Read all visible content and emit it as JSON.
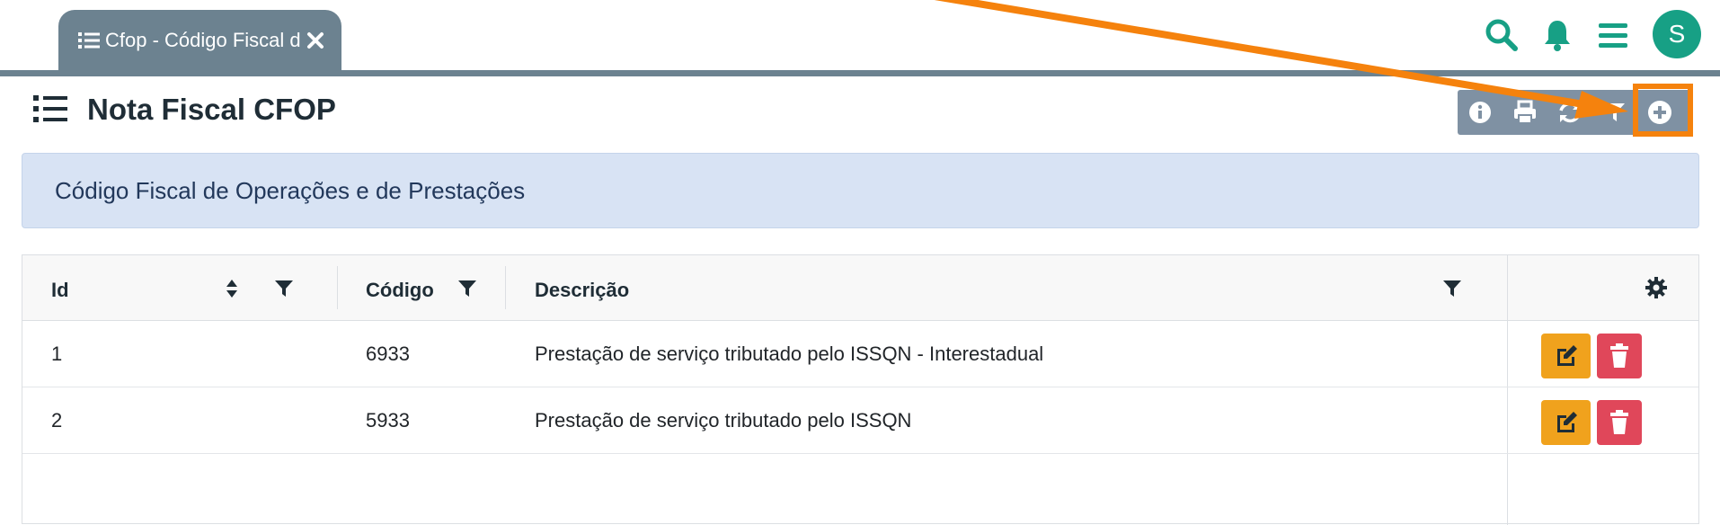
{
  "tab": {
    "label": "Cfop - Código Fiscal de Operações e de Prestações"
  },
  "user": {
    "initial": "S"
  },
  "page": {
    "title": "Nota Fiscal CFOP"
  },
  "banner": {
    "text": "Código Fiscal de Operações e de Prestações"
  },
  "table": {
    "columns": [
      "Id",
      "Código",
      "Descrição"
    ],
    "rows": [
      {
        "id": "1",
        "codigo": "6933",
        "descricao": "Prestação de serviço tributado pelo ISSQN - Interestadual"
      },
      {
        "id": "2",
        "codigo": "5933",
        "descricao": "Prestação de serviço tributado pelo ISSQN"
      }
    ]
  },
  "icons": {
    "top": [
      "search-icon",
      "bell-icon",
      "menu-icon"
    ],
    "toolbar": [
      "info-icon",
      "print-icon",
      "refresh-icon",
      "filter-icon",
      "add-circle-icon"
    ]
  },
  "colors": {
    "accent": "#17a085",
    "tab": "#6c8290",
    "toolbar": "#7f91a3",
    "annotation": "#f5820d",
    "edit": "#f0a21d",
    "delete": "#e0475a",
    "banner": "#d8e3f4"
  }
}
